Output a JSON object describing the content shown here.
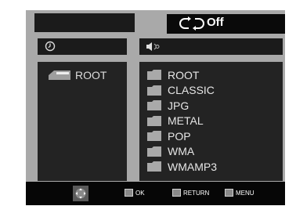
{
  "repeat": {
    "label": "Off",
    "icon": "repeat-icon"
  },
  "left_header": {
    "icon": "clock-icon"
  },
  "right_header": {
    "icon": "speaker-icon"
  },
  "tree": {
    "root_label": "ROOT",
    "root_icon": "folder-open-icon"
  },
  "folders": [
    "ROOT",
    "CLASSIC",
    "JPG",
    "METAL",
    "POP",
    "WMA",
    "WMAMP3"
  ],
  "footer": {
    "nav_icon": "navigation-pad-icon",
    "ok_label": "OK",
    "return_label": "RETURN",
    "menu_label": "MENU"
  },
  "colors": {
    "frame": "#a9a9a9",
    "panel": "#232323",
    "bar": "#060606"
  }
}
